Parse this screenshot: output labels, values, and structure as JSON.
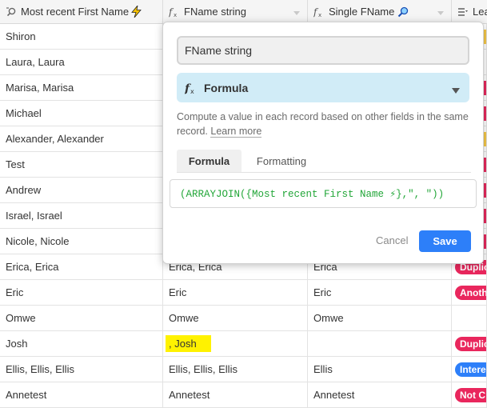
{
  "header": {
    "columns": [
      {
        "label": "Most recent First Name",
        "icon": "lookup-icon",
        "badge_icon": "lightning-icon"
      },
      {
        "label": "FName string",
        "icon": "formula-icon"
      },
      {
        "label": "Single FName",
        "icon": "formula-icon",
        "badge_icon": "magnifier-icon"
      },
      {
        "label": "Lea",
        "icon": "multi-select-icon"
      }
    ]
  },
  "rows": [
    {
      "c0": "Shiron",
      "c1": "",
      "c2": "",
      "tag": "",
      "tag_color": "#f7c948"
    },
    {
      "c0": "Laura, Laura",
      "c1": "",
      "c2": "",
      "tag": "",
      "tag_color": ""
    },
    {
      "c0": "Marisa, Marisa",
      "c1": "",
      "c2": "",
      "tag": "",
      "tag_color": "#e9275d"
    },
    {
      "c0": "Michael",
      "c1": "",
      "c2": "",
      "tag": "",
      "tag_color": "#e9275d"
    },
    {
      "c0": "Alexander, Alexander",
      "c1": "",
      "c2": "",
      "tag": "",
      "tag_color": "#f7c948"
    },
    {
      "c0": "Test",
      "c1": "",
      "c2": "",
      "tag": "",
      "tag_color": "#e9275d"
    },
    {
      "c0": "Andrew",
      "c1": "",
      "c2": "",
      "tag": "",
      "tag_color": "#e9275d"
    },
    {
      "c0": "Israel, Israel",
      "c1": "",
      "c2": "",
      "tag": "",
      "tag_color": "#e9275d"
    },
    {
      "c0": "Nicole, Nicole",
      "c1": "",
      "c2": "",
      "tag": "",
      "tag_color": "#e9275d"
    },
    {
      "c0": "Erica, Erica",
      "c1": "Erica, Erica",
      "c2": "Erica",
      "tag": "Duplic",
      "tag_color": "#e9275d"
    },
    {
      "c0": "Eric",
      "c1": "Eric",
      "c2": "Eric",
      "tag": "Anoth",
      "tag_color": "#e9275d"
    },
    {
      "c0": "Omwe",
      "c1": "Omwe",
      "c2": "Omwe",
      "tag": "",
      "tag_color": ""
    },
    {
      "c0": "Josh",
      "c1": ", Josh",
      "c2": "",
      "tag": "Duplic",
      "tag_color": "#e9275d",
      "highlight": true
    },
    {
      "c0": "Ellis, Ellis, Ellis",
      "c1": "Ellis, Ellis, Ellis",
      "c2": "Ellis",
      "tag": "Intere",
      "tag_color": "#2d7ff9"
    },
    {
      "c0": "Annetest",
      "c1": "Annetest",
      "c2": "Annetest",
      "tag": "Not C",
      "tag_color": "#e9275d"
    }
  ],
  "field_editor": {
    "field_name": "FName string",
    "field_type": "Formula",
    "field_type_icon": "formula-icon",
    "description": "Compute a value in each record based on other fields in the same record.",
    "learn_more": "Learn more",
    "tabs": [
      "Formula",
      "Formatting"
    ],
    "formula": "(ARRAYJOIN({Most recent First Name ⚡},\", \"))",
    "cancel_label": "Cancel",
    "save_label": "Save"
  },
  "colors": {
    "header_bg": "#f5f5f5",
    "type_select_bg": "#d1ecf7",
    "save_button": "#2d7ff9",
    "formula_text": "#22a638",
    "highlight": "#fff200"
  }
}
